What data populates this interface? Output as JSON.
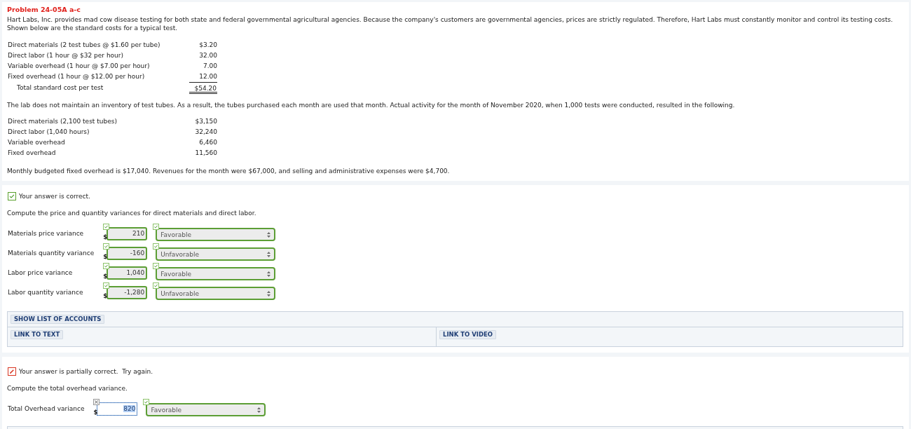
{
  "problem": {
    "title": "Problem 24-05A a-c",
    "intro": "Hart Labs, Inc. provides mad cow disease testing for both state and federal governmental agricultural agencies. Because the company's customers are governmental agencies, prices are strictly regulated. Therefore, Hart Labs must constantly monitor and control its testing costs. Shown below are the standard costs for a typical test.",
    "standard_costs": [
      {
        "label": "Direct materials (2 test tubes @ $1.60 per tube)",
        "amount": "$3.20"
      },
      {
        "label": "Direct labor (1 hour @ $32 per hour)",
        "amount": "32.00"
      },
      {
        "label": "Variable overhead (1 hour @ $7.00 per hour)",
        "amount": "7.00"
      },
      {
        "label": "Fixed overhead (1 hour @ $12.00 per hour)",
        "amount": "12.00"
      }
    ],
    "standard_total": {
      "label": "Total standard cost per test",
      "amount": "$54.20"
    },
    "activity_note": "The lab does not maintain an inventory of test tubes. As a result, the tubes purchased each month are used that month. Actual activity for the month of November 2020, when 1,000 tests were conducted, resulted in the following.",
    "actual_costs": [
      {
        "label": "Direct materials (2,100 test tubes)",
        "amount": "$3,150"
      },
      {
        "label": "Direct labor (1,040 hours)",
        "amount": "32,240"
      },
      {
        "label": "Variable overhead",
        "amount": "6,460"
      },
      {
        "label": "Fixed overhead",
        "amount": "11,560"
      }
    ],
    "closing_note": "Monthly budgeted fixed overhead is $17,040. Revenues for the month were $67,000, and selling and administrative expenses were $4,700."
  },
  "parts": [
    {
      "result": {
        "correct": true,
        "text": "Your answer is correct."
      },
      "instruction": "Compute the price and quantity variances for direct materials and direct labor.",
      "answers": [
        {
          "label": "Materials price variance",
          "currency": "$",
          "amount": "210",
          "amount_correct": true,
          "focused": false,
          "direction": "Favorable",
          "direction_correct": true
        },
        {
          "label": "Materials quantity variance",
          "currency": "$",
          "amount": "-160",
          "amount_correct": true,
          "focused": false,
          "direction": "Unfavorable",
          "direction_correct": true
        },
        {
          "label": "Labor price variance",
          "currency": "$",
          "amount": "1,040",
          "amount_correct": true,
          "focused": false,
          "direction": "Favorable",
          "direction_correct": true
        },
        {
          "label": "Labor quantity variance",
          "currency": "$",
          "amount": "-1,280",
          "amount_correct": true,
          "focused": false,
          "direction": "Unfavorable",
          "direction_correct": true
        }
      ],
      "resources": {
        "accounts_button": "SHOW LIST OF ACCOUNTS",
        "text_link": "LINK TO TEXT",
        "video_link": "LINK TO VIDEO"
      }
    },
    {
      "result": {
        "correct": false,
        "text": "Your answer is partially correct.  Try again."
      },
      "instruction": "Compute the total overhead variance.",
      "answers": [
        {
          "label": "Total Overhead variance",
          "currency": "$",
          "amount": "820",
          "amount_correct": false,
          "focused": true,
          "direction": "Favorable",
          "direction_correct": true
        }
      ]
    }
  ]
}
